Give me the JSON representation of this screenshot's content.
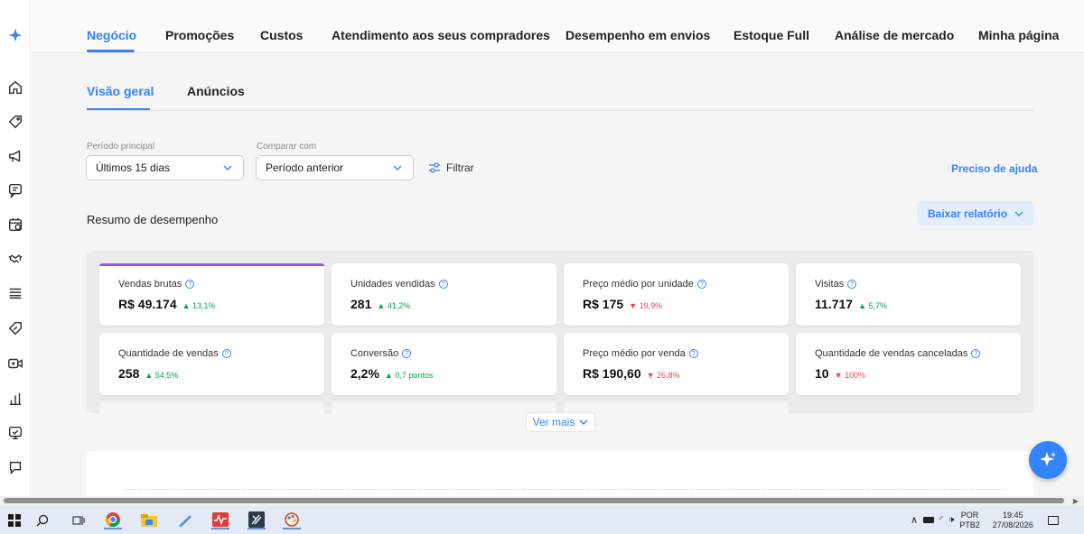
{
  "top_nav": {
    "tabs": [
      {
        "label": "Negócio",
        "active": true
      },
      {
        "label": "Promoções"
      },
      {
        "label": "Custos"
      },
      {
        "label": "Atendimento aos seus compradores"
      },
      {
        "label": "Desempenho em envios"
      },
      {
        "label": "Estoque Full"
      },
      {
        "label": "Análise de mercado"
      },
      {
        "label": "Minha página"
      }
    ]
  },
  "sub_tabs": [
    {
      "label": "Visão geral",
      "active": true
    },
    {
      "label": "Anúncios"
    }
  ],
  "filters": {
    "main_period_label": "Período principal",
    "main_period_value": "Últimos 15 dias",
    "compare_label": "Comparar com",
    "compare_value": "Período anterior",
    "filter_button": "Filtrar",
    "help_link": "Preciso de ajuda"
  },
  "summary": {
    "title": "Resumo de desempenho",
    "download_button": "Baixar relatório",
    "see_more": "Ver mais"
  },
  "metrics": [
    {
      "label": "Vendas brutas",
      "value": "R$ 49.174",
      "delta": "13,1%",
      "trend": "up"
    },
    {
      "label": "Unidades vendidas",
      "value": "281",
      "delta": "41,2%",
      "trend": "up"
    },
    {
      "label": "Preço médio por unidade",
      "value": "R$ 175",
      "delta": "19,9%",
      "trend": "down"
    },
    {
      "label": "Visitas",
      "value": "11.717",
      "delta": "5,7%",
      "trend": "up"
    },
    {
      "label": "Quantidade de vendas",
      "value": "258",
      "delta": "54,5%",
      "trend": "up"
    },
    {
      "label": "Conversão",
      "value": "2,2%",
      "delta": "0,7 pontos",
      "trend": "up"
    },
    {
      "label": "Preço médio por venda",
      "value": "R$ 190,60",
      "delta": "26,8%",
      "trend": "down"
    },
    {
      "label": "Quantidade de vendas canceladas",
      "value": "10",
      "delta": "100%",
      "trend": "down"
    }
  ],
  "colors": {
    "accent": "#3483fa",
    "highlight_bar": "#9a55e6",
    "up": "#00a650",
    "down": "#f23d4f"
  },
  "taskbar": {
    "lang_line1": "POR",
    "lang_line2": "PTB2",
    "time": "19:45",
    "date": "27/08/2026"
  },
  "icons": {
    "rail": [
      "sparkle-icon",
      "home-icon",
      "tag-icon",
      "megaphone-icon",
      "chat-icon",
      "calendar-check-icon",
      "handshake-icon",
      "stack-icon",
      "discount-tag-icon",
      "video-icon",
      "bar-chart-icon",
      "monitor-icon",
      "message-icon"
    ]
  }
}
